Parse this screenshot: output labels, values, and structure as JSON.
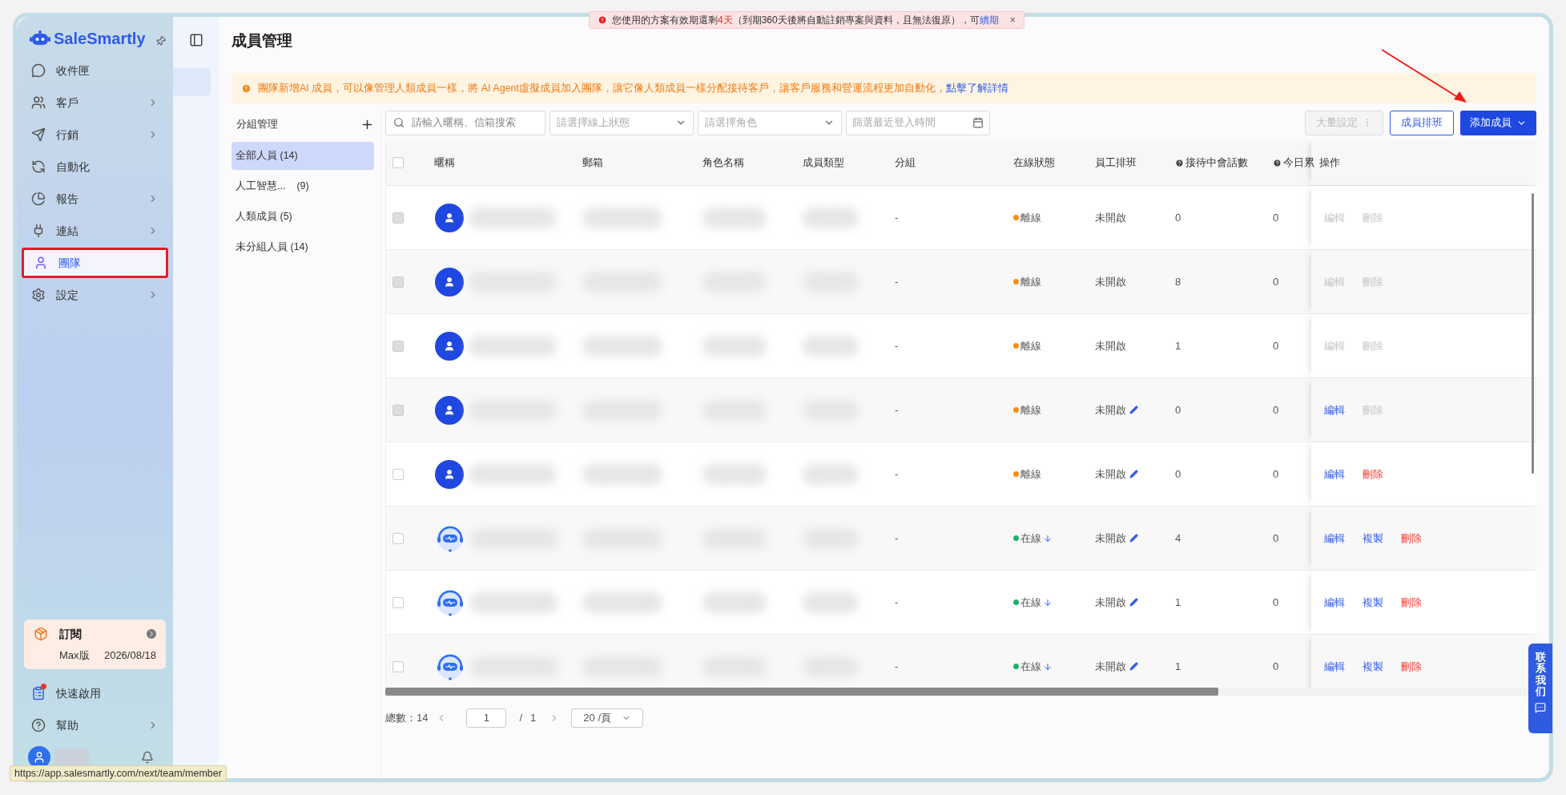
{
  "notice": {
    "text": "您使用的方案有效期還剩",
    "days": "4天",
    "rest": "（到期360天後將自動註銷專案與資料，且無法復原），可",
    "link": "續期",
    "close": "×"
  },
  "sidebar": {
    "logo": "SaleSmartly",
    "items": [
      {
        "label": "收件匣",
        "chevron": false,
        "selected": false
      },
      {
        "label": "客戶",
        "chevron": true,
        "selected": false
      },
      {
        "label": "行銷",
        "chevron": true,
        "selected": false
      },
      {
        "label": "自動化",
        "chevron": false,
        "selected": false
      },
      {
        "label": "報告",
        "chevron": true,
        "selected": false
      },
      {
        "label": "連結",
        "chevron": true,
        "selected": false
      },
      {
        "label": "團隊",
        "chevron": false,
        "selected": true
      },
      {
        "label": "設定",
        "chevron": true,
        "selected": false
      }
    ],
    "subscription": {
      "title": "訂閱",
      "plan": "Max版",
      "date": "2026/08/18"
    },
    "bottom_items": [
      {
        "label": "快速啟用",
        "chevron": false,
        "dot": true
      },
      {
        "label": "幫助",
        "chevron": true,
        "dot": false
      }
    ]
  },
  "page_title": "成員管理",
  "banner": {
    "text": "團隊新增AI 成員，可以像管理人類成員一樣，將 AI Agent虛擬成員加入團隊，讓它像人類成員一樣分配接待客戶，讓客戶服務和營運流程更加自動化，",
    "link": "點擊了解詳情"
  },
  "groups": {
    "title": "分組管理",
    "items": [
      {
        "label": "全部人員 (14)",
        "selected": true
      },
      {
        "label": "人工智慧...",
        "count": "(9)",
        "selected": false
      },
      {
        "label": "人類成員 (5)",
        "selected": false
      },
      {
        "label": "未分組人員 (14)",
        "selected": false
      }
    ]
  },
  "filters": {
    "search_placeholder": "請輸入暱稱、信箱搜索",
    "status_placeholder": "請選擇線上狀態",
    "role_placeholder": "請選擇角色",
    "date_placeholder": "篩選最近登入時間"
  },
  "buttons": {
    "bulk": "大量設定",
    "bulk_disabled": true,
    "schedule": "成員排班",
    "add": "添加成員"
  },
  "table": {
    "select_all_checked": false,
    "columns": [
      "暱稱",
      "郵箱",
      "角色名稱",
      "成員類型",
      "分組",
      "在線狀態",
      "員工排班",
      "接待中會話數",
      "今日累",
      "操作"
    ],
    "rows": [
      {
        "kind": "human",
        "checkbox_disabled": true,
        "group": "-",
        "status": "離線",
        "color": "#fa8c16",
        "transfer": false,
        "schedule": "未開啟",
        "schedule_editable": false,
        "sessions": "0",
        "today": "0",
        "actions": [
          {
            "label": "編輯",
            "kind": "edit",
            "disabled": true
          },
          {
            "label": "刪除",
            "kind": "delete",
            "disabled": true
          }
        ]
      },
      {
        "kind": "human",
        "checkbox_disabled": true,
        "group": "-",
        "status": "離線",
        "color": "#fa8c16",
        "transfer": false,
        "schedule": "未開啟",
        "schedule_editable": false,
        "sessions": "8",
        "today": "0",
        "actions": [
          {
            "label": "編輯",
            "kind": "edit",
            "disabled": true
          },
          {
            "label": "刪除",
            "kind": "delete",
            "disabled": true
          }
        ]
      },
      {
        "kind": "human",
        "checkbox_disabled": true,
        "group": "-",
        "status": "離線",
        "color": "#fa8c16",
        "transfer": false,
        "schedule": "未開啟",
        "schedule_editable": false,
        "sessions": "1",
        "today": "0",
        "actions": [
          {
            "label": "編輯",
            "kind": "edit",
            "disabled": true
          },
          {
            "label": "刪除",
            "kind": "delete",
            "disabled": true
          }
        ]
      },
      {
        "kind": "human",
        "checkbox_disabled": true,
        "group": "-",
        "status": "離線",
        "color": "#fa8c16",
        "transfer": false,
        "schedule": "未開啟",
        "schedule_editable": true,
        "sessions": "0",
        "today": "0",
        "actions": [
          {
            "label": "編輯",
            "kind": "edit",
            "disabled": false
          },
          {
            "label": "刪除",
            "kind": "delete",
            "disabled": true
          }
        ]
      },
      {
        "kind": "human",
        "checkbox_disabled": false,
        "group": "-",
        "status": "離線",
        "color": "#fa8c16",
        "transfer": false,
        "schedule": "未開啟",
        "schedule_editable": true,
        "sessions": "0",
        "today": "0",
        "actions": [
          {
            "label": "編輯",
            "kind": "edit",
            "disabled": false
          },
          {
            "label": "刪除",
            "kind": "delete",
            "disabled": false
          }
        ]
      },
      {
        "kind": "bot",
        "checkbox_disabled": false,
        "group": "-",
        "status": "在線",
        "color": "#19b36b",
        "transfer": true,
        "schedule": "未開啟",
        "schedule_editable": true,
        "sessions": "4",
        "today": "0",
        "actions": [
          {
            "label": "編輯",
            "kind": "edit",
            "disabled": false
          },
          {
            "label": "複製",
            "kind": "copy",
            "disabled": false
          },
          {
            "label": "刪除",
            "kind": "delete",
            "disabled": false
          }
        ]
      },
      {
        "kind": "bot",
        "checkbox_disabled": false,
        "group": "-",
        "status": "在線",
        "color": "#19b36b",
        "transfer": true,
        "schedule": "未開啟",
        "schedule_editable": true,
        "sessions": "1",
        "today": "0",
        "actions": [
          {
            "label": "編輯",
            "kind": "edit",
            "disabled": false
          },
          {
            "label": "複製",
            "kind": "copy",
            "disabled": false
          },
          {
            "label": "刪除",
            "kind": "delete",
            "disabled": false
          }
        ]
      },
      {
        "kind": "bot",
        "checkbox_disabled": false,
        "group": "-",
        "status": "在線",
        "color": "#19b36b",
        "transfer": true,
        "schedule": "未開啟",
        "schedule_editable": true,
        "sessions": "1",
        "today": "0",
        "actions": [
          {
            "label": "編輯",
            "kind": "edit",
            "disabled": false
          },
          {
            "label": "複製",
            "kind": "copy",
            "disabled": false
          },
          {
            "label": "刪除",
            "kind": "delete",
            "disabled": false
          }
        ]
      }
    ]
  },
  "pagination": {
    "total": "總數：14",
    "page": "1",
    "separator": "/",
    "pages": "1",
    "size": "20 /頁"
  },
  "contact": "联系我们",
  "status_url": "https://app.salesmartly.com/next/team/member"
}
